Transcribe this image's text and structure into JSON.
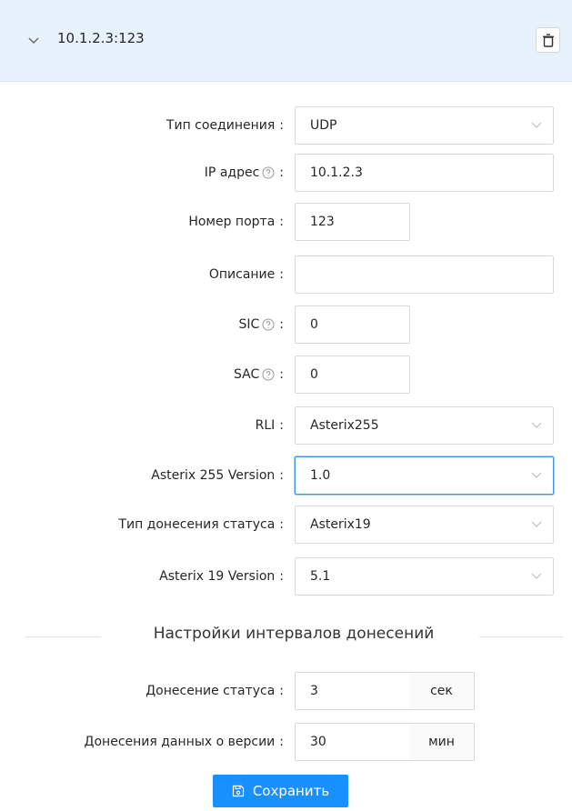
{
  "header": {
    "title": "10.1.2.3:123"
  },
  "icons": {
    "expand": "chevron-down-icon",
    "delete": "trash-icon",
    "help": "question-circle-icon",
    "save": "floppy-disk-icon"
  },
  "colors": {
    "header_bg": "#e8f2fc",
    "primary": "#1890ff",
    "focus": "#4096e8"
  },
  "form": {
    "connection_type": {
      "label": "Тип соединения",
      "value": "UDP"
    },
    "ip_address": {
      "label": "IP адрес",
      "value": "10.1.2.3"
    },
    "port": {
      "label": "Номер порта",
      "value": "123"
    },
    "description": {
      "label": "Описание",
      "value": ""
    },
    "sic": {
      "label": "SIC",
      "value": "0"
    },
    "sac": {
      "label": "SAC",
      "value": "0"
    },
    "rli": {
      "label": "RLI",
      "value": "Asterix255"
    },
    "asterix255_version": {
      "label": "Asterix 255 Version",
      "value": "1.0"
    },
    "status_report_type": {
      "label": "Тип донесения статуса",
      "value": "Asterix19"
    },
    "asterix19_version": {
      "label": "Asterix 19 Version",
      "value": "5.1"
    }
  },
  "intervals": {
    "section_title": "Настройки интервалов донесений",
    "status_report": {
      "label": "Донесение статуса",
      "value": "3",
      "unit": "сек"
    },
    "version_report": {
      "label": "Донесения данных о версии",
      "value": "30",
      "unit": "мин"
    }
  },
  "save_label": "Сохранить"
}
